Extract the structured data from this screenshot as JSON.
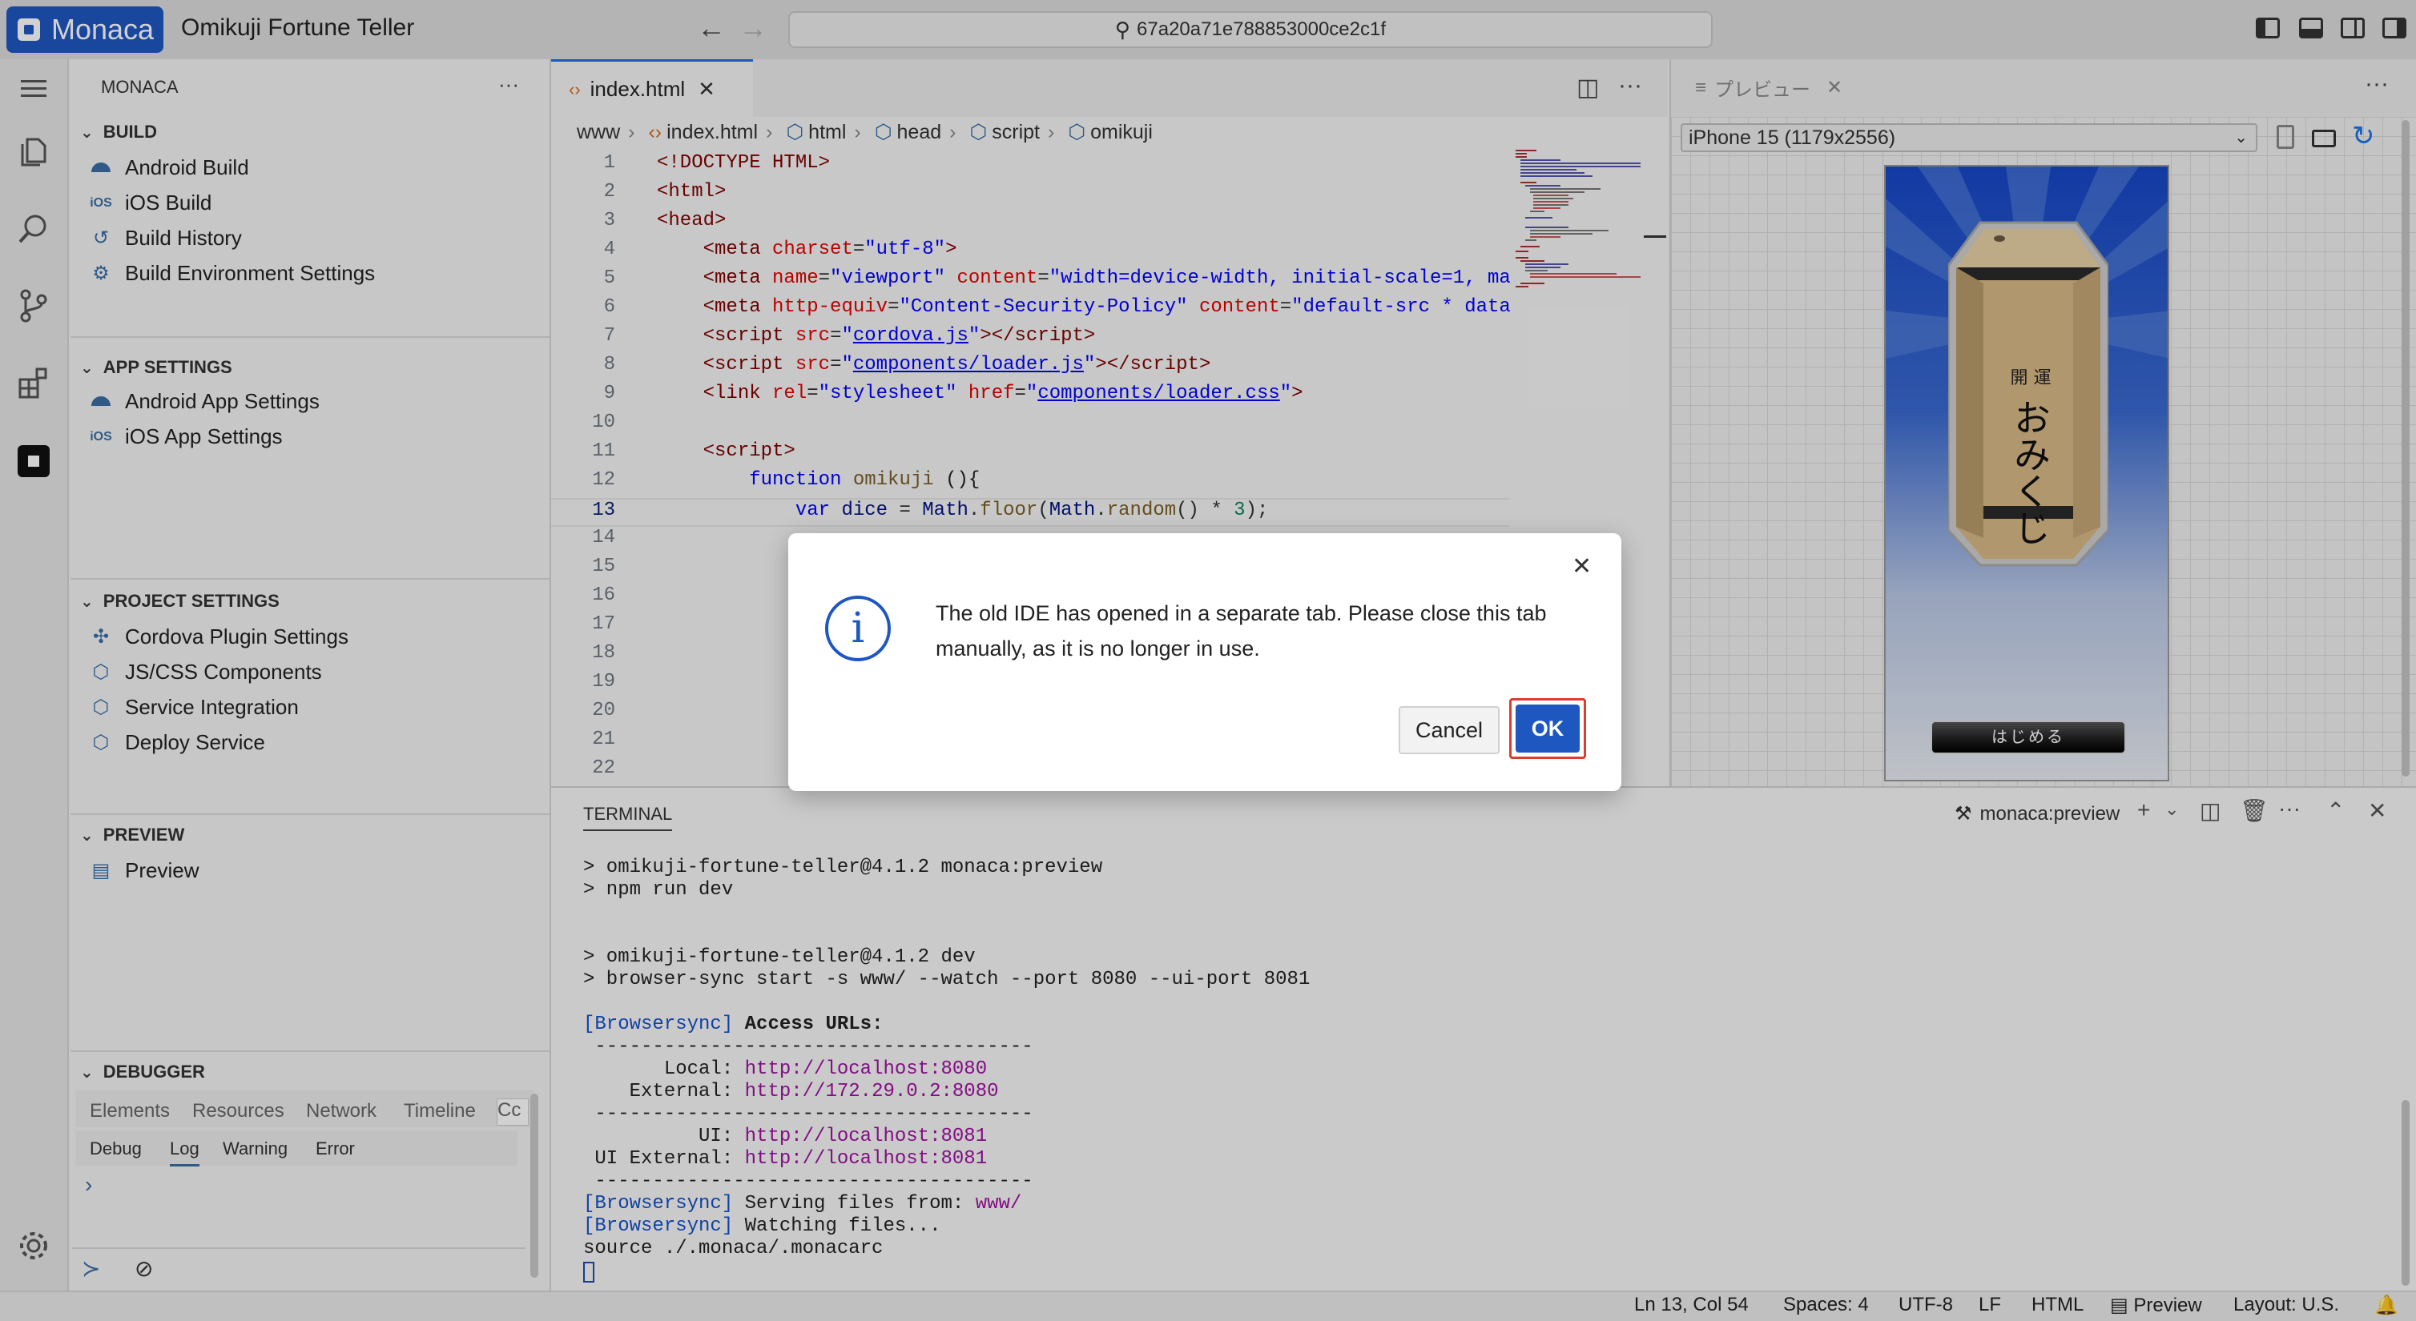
{
  "titlebar": {
    "brand": "Monaca",
    "app_title": "Omikuji Fortune Teller",
    "search_text": "67a20a71e788853000ce2c1f"
  },
  "sidebar": {
    "header": "MONACA",
    "more": "···",
    "build": {
      "title": "BUILD",
      "items": [
        "Android Build",
        "iOS Build",
        "Build History",
        "Build Environment Settings"
      ]
    },
    "app_settings": {
      "title": "APP SETTINGS",
      "items": [
        "Android App Settings",
        "iOS App Settings"
      ]
    },
    "project_settings": {
      "title": "PROJECT SETTINGS",
      "items": [
        "Cordova Plugin Settings",
        "JS/CSS Components",
        "Service Integration",
        "Deploy Service"
      ]
    },
    "preview": {
      "title": "PREVIEW",
      "items": [
        "Preview"
      ]
    },
    "debugger": {
      "title": "DEBUGGER",
      "tabs": [
        "Elements",
        "Resources",
        "Network",
        "Timeline",
        "Cc"
      ],
      "subtabs": [
        "Debug",
        "Log",
        "Warning",
        "Error"
      ],
      "active_subtab": "Log",
      "prompt": "›"
    },
    "ios_badge": "iOS"
  },
  "editor": {
    "tab_label": "index.html",
    "breadcrumb": [
      "www",
      "index.html",
      "html",
      "head",
      "script",
      "omikuji"
    ],
    "current_line": 13
  },
  "preview": {
    "tab_label": "プレビュー",
    "device": "iPhone 15 (1179x2556)",
    "box_text_top": "開 運",
    "box_text_main": "おみくじ",
    "start_button": "はじめる"
  },
  "terminal": {
    "tab_label": "TERMINAL",
    "task_label": "monaca:preview",
    "lines": [
      "> omikuji-fortune-teller@4.1.2 monaca:preview",
      "> npm run dev",
      "",
      "",
      "> omikuji-fortune-teller@4.1.2 dev",
      "> browser-sync start -s www/ --watch --port 8080 --ui-port 8081",
      ""
    ],
    "bs_tag": "[Browsersync]",
    "access_urls": "Access URLs:",
    "rule": " --------------------------------------",
    "local_label": "       Local: ",
    "local_url": "http://localhost:8080",
    "external_label": "    External: ",
    "external_url": "http://172.29.0.2:8080",
    "ui_label": "          UI: ",
    "ui_url": "http://localhost:8081",
    "ui_external_label": " UI External: ",
    "ui_external_url": "http://localhost:8081",
    "serving": " Serving files from: ",
    "serving_dir": "www/",
    "watching": " Watching files...",
    "source_line": "source ./.monaca/.monacarc"
  },
  "statusbar": {
    "position": "Ln 13, Col 54",
    "spaces": "Spaces: 4",
    "encoding": "UTF-8",
    "eol": "LF",
    "language": "HTML",
    "preview": "Preview",
    "layout": "Layout: U.S."
  },
  "dialog": {
    "message": "The old IDE has opened in a separate tab. Please close this tab manually, as it is no longer in use.",
    "cancel_label": "Cancel",
    "ok_label": "OK"
  },
  "colors": {
    "brand": "#1f57c1",
    "accent": "#1a73e8",
    "ok_focus_ring": "#e03b2f"
  }
}
